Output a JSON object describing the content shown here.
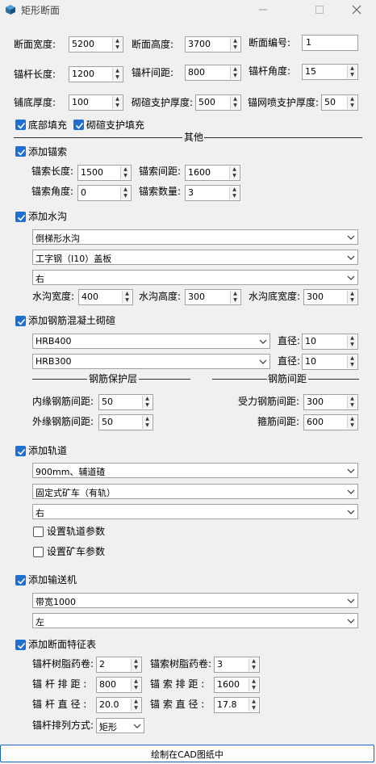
{
  "window": {
    "title": "矩形断面"
  },
  "top": {
    "width_label": "断面宽度:",
    "width_value": "5200",
    "height_label": "断面高度:",
    "height_value": "3700",
    "id_label": "断面编号:",
    "id_value": "1",
    "bolt_len_label": "锚杆长度:",
    "bolt_len_value": "1200",
    "bolt_spacing_label": "锚杆间距:",
    "bolt_spacing_value": "800",
    "bolt_angle_label": "锚杆角度:",
    "bolt_angle_value": "15",
    "floor_thk_label": "铺底厚度:",
    "floor_thk_value": "100",
    "masonry_thk_label": "砌碹支护厚度:",
    "masonry_thk_value": "500",
    "mesh_thk_label": "锚网喷支护厚度:",
    "mesh_thk_value": "50",
    "floor_fill_label": "底部填充",
    "masonry_fill_label": "砌碹支护填充",
    "other_label": "其他"
  },
  "cable": {
    "header": "添加锚索",
    "len_label": "锚索长度:",
    "len_value": "1500",
    "spacing_label": "锚索间距:",
    "spacing_value": "1600",
    "angle_label": "锚索角度:",
    "angle_value": "0",
    "count_label": "锚索数量:",
    "count_value": "3"
  },
  "ditch": {
    "header": "添加水沟",
    "shape": "倒梯形水沟",
    "cover": "工字钢（I10）盖板",
    "side": "右",
    "width_label": "水沟宽度:",
    "width_value": "400",
    "height_label": "水沟高度:",
    "height_value": "300",
    "bottom_label": "水沟底宽度:",
    "bottom_value": "300"
  },
  "rc": {
    "header": "添加钢筋混凝土砌碹",
    "steel1": "HRB400",
    "dia1_label": "直径:",
    "dia1_value": "10",
    "steel2": "HRB300",
    "dia2_label": "直径:",
    "dia2_value": "10",
    "cover_label": "钢筋保护层",
    "spacing_label": "钢筋间距",
    "inner_label": "内缘钢筋间距:",
    "inner_value": "50",
    "outer_label": "外缘钢筋间距:",
    "outer_value": "50",
    "main_label": "受力钢筋间距:",
    "main_value": "300",
    "stirrup_label": "箍筋间距:",
    "stirrup_value": "600"
  },
  "track": {
    "header": "添加轨道",
    "gauge": "900mm、辅道碴",
    "car": "固定式矿车（有轨）",
    "side": "右",
    "set_track_label": "设置轨道参数",
    "set_car_label": "设置矿车参数"
  },
  "conveyor": {
    "header": "添加输送机",
    "belt": "带宽1000",
    "side": "左"
  },
  "feature": {
    "header": "添加断面特征表",
    "bolt_resin_label": "锚杆树脂药卷:",
    "bolt_resin_value": "2",
    "cable_resin_label": "锚索树脂药卷:",
    "cable_resin_value": "3",
    "bolt_row_label": "锚 杆 排 距 :",
    "bolt_row_value": "800",
    "cable_row_label": "锚 索 排 距 :",
    "cable_row_value": "1600",
    "bolt_dia_label": "锚 杆 直 径 :",
    "bolt_dia_value": "20.0",
    "cable_dia_label": "锚 索 直 径 :",
    "cable_dia_value": "17.8",
    "layout_label": "锚杆排列方式:",
    "layout_value": "矩形"
  },
  "draw_button": "绘制在CAD图纸中"
}
